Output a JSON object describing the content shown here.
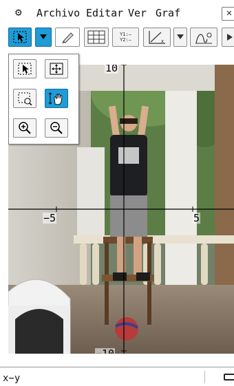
{
  "menubar": {
    "gear_icon": "gear-icon",
    "items": [
      "Archivo",
      "Editar",
      "Ver",
      "Graf"
    ],
    "close_label": "✕"
  },
  "toolbar": {
    "y_list_label_1": "Y1:—",
    "y_list_label_2": "Y2:—",
    "accent_color": "#1e9cd8"
  },
  "graph": {
    "x_range": [
      -8,
      8
    ],
    "y_range": [
      -11,
      11
    ],
    "labels": {
      "y_top": "10",
      "y_bottom": "−10",
      "x_left": "−5",
      "x_right": "5"
    }
  },
  "status": {
    "mode": "x−y"
  }
}
